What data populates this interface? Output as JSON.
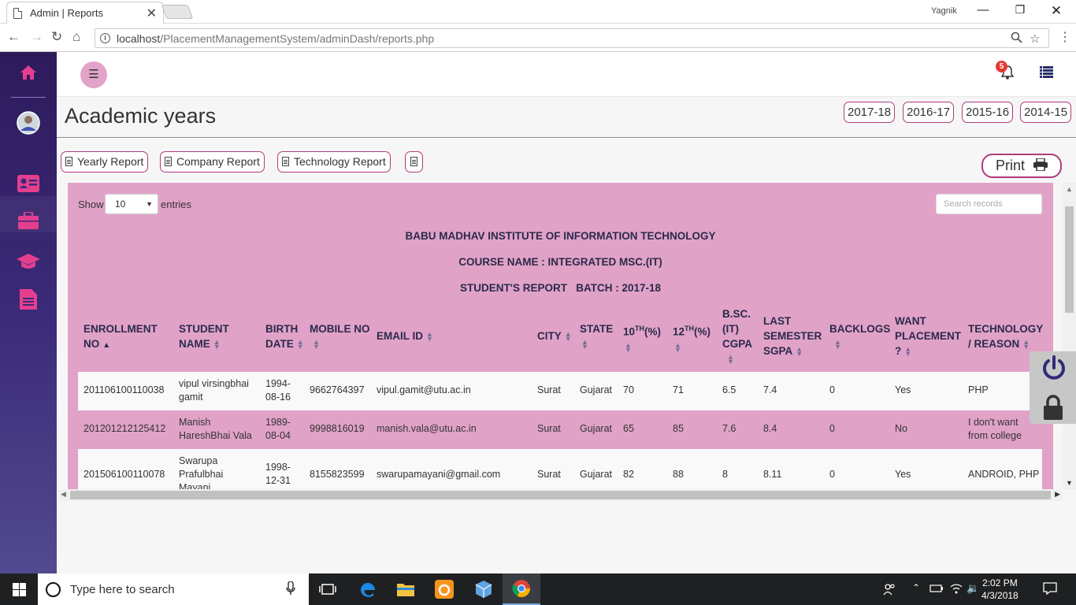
{
  "browser": {
    "tab_title": "Admin | Reports",
    "profile_name": "Yagnik",
    "url_host": "localhost",
    "url_path": "/PlacementManagementSystem/adminDash/reports.php"
  },
  "topbar": {
    "notification_count": "5"
  },
  "header": {
    "title": "Academic years",
    "years": [
      "2017-18",
      "2016-17",
      "2015-16",
      "2014-15"
    ]
  },
  "reports": {
    "yearly": "Yearly Report",
    "company": "Company Report",
    "technology": "Technology Report",
    "print": "Print"
  },
  "table_controls": {
    "show_label": "Show",
    "entries_value": "10",
    "entries_label": "entries",
    "search_placeholder": "Search records"
  },
  "report_heading": {
    "institute": "BABU MADHAV INSTITUTE OF INFORMATION TECHNOLOGY",
    "course": "COURSE NAME : INTEGRATED MSC.(IT)",
    "batch": "STUDENT'S REPORT   BATCH : 2017-18"
  },
  "columns": {
    "enroll_1": "ENROLLMENT",
    "enroll_2": "NO",
    "name_1": "STUDENT",
    "name_2": "NAME",
    "birth_1": "BIRTH",
    "birth_2": "DATE",
    "mobile": "MOBILE NO",
    "email": "EMAIL ID",
    "city": "CITY",
    "state": "STATE",
    "tenth_a": "10",
    "tenth_sup": "TH",
    "tenth_b": "(%)",
    "twelfth_a": "12",
    "twelfth_sup": "TH",
    "twelfth_b": "(%)",
    "bsc_1": "B.SC.",
    "bsc_2": "(IT)",
    "bsc_3": "CGPA",
    "sgpa_1": "LAST",
    "sgpa_2": "SEMESTER",
    "sgpa_3": "SGPA",
    "backlogs": "BACKLOGS",
    "want_1": "WANT",
    "want_2": "PLACEMENT",
    "want_3": "?",
    "tech_1": "TECHNOLOGY",
    "tech_2": "/ REASON"
  },
  "rows": [
    {
      "enroll": "201106100110038",
      "name_1": "vipul virsingbhai",
      "name_2": "gamit",
      "name_3": "",
      "birth_1": "1994-",
      "birth_2": "08-16",
      "mobile": "9662764397",
      "email": "vipul.gamit@utu.ac.in",
      "city": "Surat",
      "state": "Gujarat",
      "tenth": "70",
      "twelfth": "71",
      "cgpa": "6.5",
      "sgpa": "7.4",
      "backlogs": "0",
      "want": "Yes",
      "tech_1": "PHP",
      "tech_2": ""
    },
    {
      "enroll": "201201212125412",
      "name_1": "Manish",
      "name_2": "HareshBhai Vala",
      "name_3": "",
      "birth_1": "1989-",
      "birth_2": "08-04",
      "mobile": "9998816019",
      "email": "manish.vala@utu.ac.in",
      "city": "Surat",
      "state": "Gujarat",
      "tenth": "65",
      "twelfth": "85",
      "cgpa": "7.6",
      "sgpa": "8.4",
      "backlogs": "0",
      "want": "No",
      "tech_1": "I don't want",
      "tech_2": "from college"
    },
    {
      "enroll": "201506100110078",
      "name_1": "Swarupa",
      "name_2": "Prafulbhai",
      "name_3": "Mayani",
      "birth_1": "1998-",
      "birth_2": "12-31",
      "mobile": "8155823599",
      "email": "swarupamayani@gmail.com",
      "city": "Surat",
      "state": "Gujarat",
      "tenth": "82",
      "twelfth": "88",
      "cgpa": "8",
      "sgpa": "8.11",
      "backlogs": "0",
      "want": "Yes",
      "tech_1": "ANDROID, PHP",
      "tech_2": ""
    }
  ],
  "taskbar": {
    "search_placeholder": "Type here to search",
    "time": "2:02 PM",
    "date": "4/3/2018"
  },
  "colors": {
    "sidebar": "#3b2a78",
    "accent_pink": "#e1a2c8",
    "button_border": "#b13b7b",
    "sidebar_icon": "#e43f8f"
  }
}
